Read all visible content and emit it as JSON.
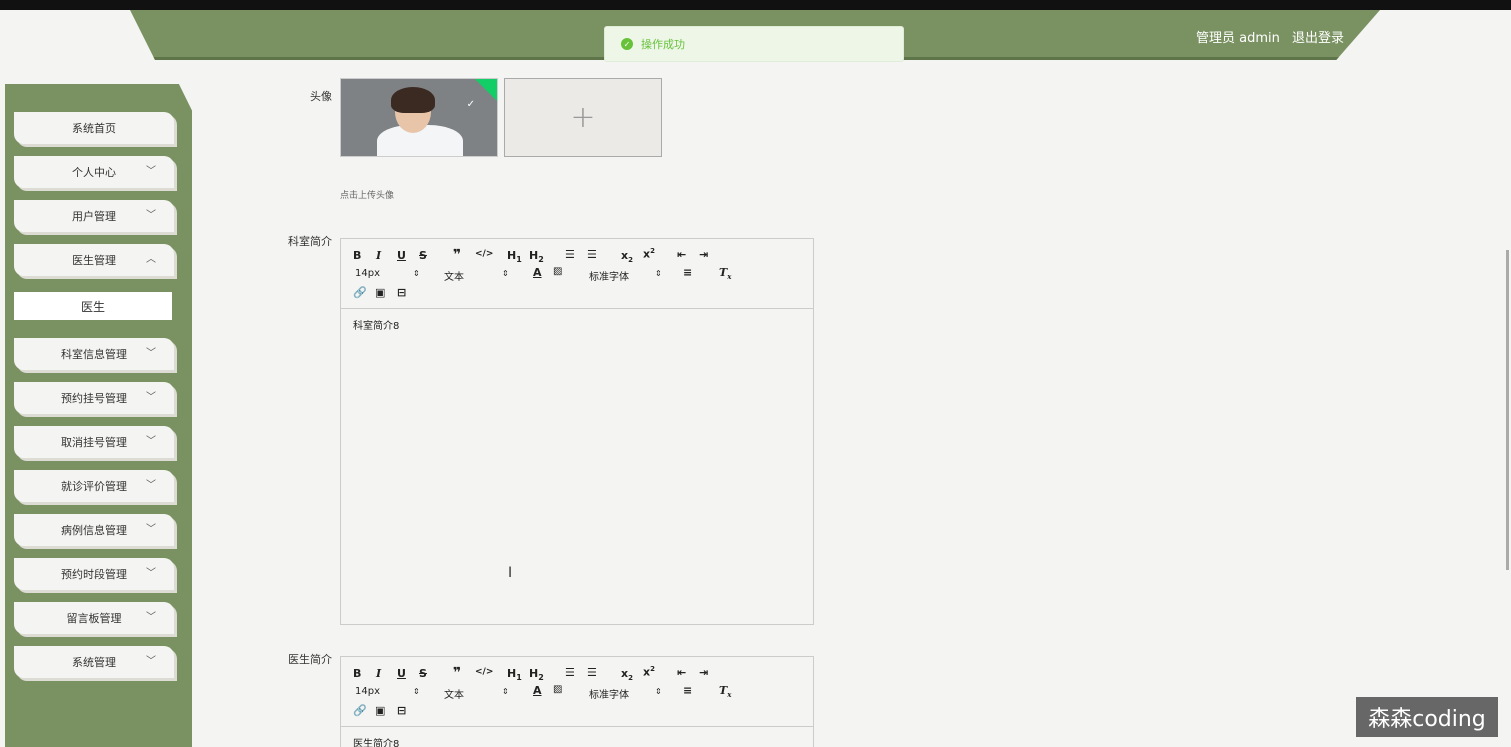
{
  "header": {
    "user_label": "管理员 admin",
    "logout": "退出登录"
  },
  "toast": {
    "message": "操作成功",
    "icon": "success-check-icon"
  },
  "sidebar": {
    "items": [
      {
        "label": "系统首页"
      },
      {
        "label": "个人中心"
      },
      {
        "label": "用户管理"
      },
      {
        "label": "医生管理"
      },
      {
        "label": "医生"
      },
      {
        "label": "科室信息管理"
      },
      {
        "label": "预约挂号管理"
      },
      {
        "label": "取消挂号管理"
      },
      {
        "label": "就诊评价管理"
      },
      {
        "label": "病例信息管理"
      },
      {
        "label": "预约时段管理"
      },
      {
        "label": "留言板管理"
      },
      {
        "label": "系统管理"
      }
    ]
  },
  "form": {
    "avatar_label": "头像",
    "upload_hint": "点击上传头像",
    "dept_label": "科室简介",
    "dept_content": "科室简介8",
    "doctor_label": "医生简介",
    "doctor_content": "医生简介8"
  },
  "toolbar": {
    "size": "14px",
    "format": "文本",
    "font": "标准字体"
  },
  "watermark": "森森coding"
}
